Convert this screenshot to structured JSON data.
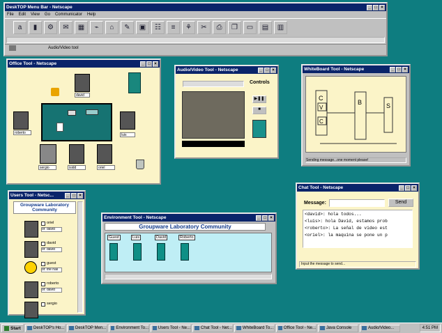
{
  "menubar": {
    "title": "DeskTOP Menu Bar - Netscape",
    "menus": [
      "File",
      "Edit",
      "View",
      "Go",
      "Communicator",
      "Help"
    ],
    "tools": [
      "a",
      "▮",
      "⚙",
      "✉",
      "▦",
      "⌁",
      "⌂",
      "✎",
      "▣",
      "☷",
      "≡",
      "⚘",
      "✂",
      "⎙",
      "❐",
      "▭",
      "▤",
      "▥"
    ],
    "status_label": "Audio/Video tool"
  },
  "office": {
    "title": "Office Tool - Netscape",
    "people": [
      "david",
      "roberto",
      "luis",
      "sergio",
      "isidd",
      "oriel"
    ]
  },
  "av": {
    "title": "Audio/Video Tool - Netscape",
    "controls_label": "Controls"
  },
  "whiteboard": {
    "title": "WhiteBoard Tool - Netscape",
    "status": "Sending message...one moment please!",
    "labels": [
      "C",
      "V",
      "C",
      "B",
      "S"
    ]
  },
  "users": {
    "title": "Users Tool - Netsc...",
    "heading": "Groupware Laboratory Community",
    "users": [
      {
        "name": "oriel",
        "status": "of: david"
      },
      {
        "name": "david",
        "status": "of: david"
      },
      {
        "name": "guest",
        "status": "of: the hall"
      },
      {
        "name": "roberto",
        "status": "of: david"
      },
      {
        "name": "sergio",
        "status": ""
      }
    ]
  },
  "environment": {
    "title": "Environment Tool - Netscape",
    "heading": "Groupware Laboratory Community",
    "rooms": [
      "Guest",
      "Luis",
      "David",
      "Roberto"
    ]
  },
  "chat": {
    "title": "Chat Tool - Netscape",
    "message_label": "Message:",
    "send_label": "Send",
    "lines": [
      "<david>: hola todos...",
      "<luis>: hola David, estamos prob",
      "<roberto>: La señal de video est",
      "<oriel>: la maquina se pone un p"
    ],
    "hint": "Input the message to send..."
  },
  "taskbar": {
    "start": "Start",
    "items": [
      "DeskTOP's Ho...",
      "DeskTOP Men...",
      "Environment To...",
      "Users Tool - Ne...",
      "Chat Tool - Net...",
      "WhiteBoard To...",
      "Office Tool - Ne...",
      "Java Console",
      "Audio/Video..."
    ],
    "clock": "4:51 PM"
  }
}
